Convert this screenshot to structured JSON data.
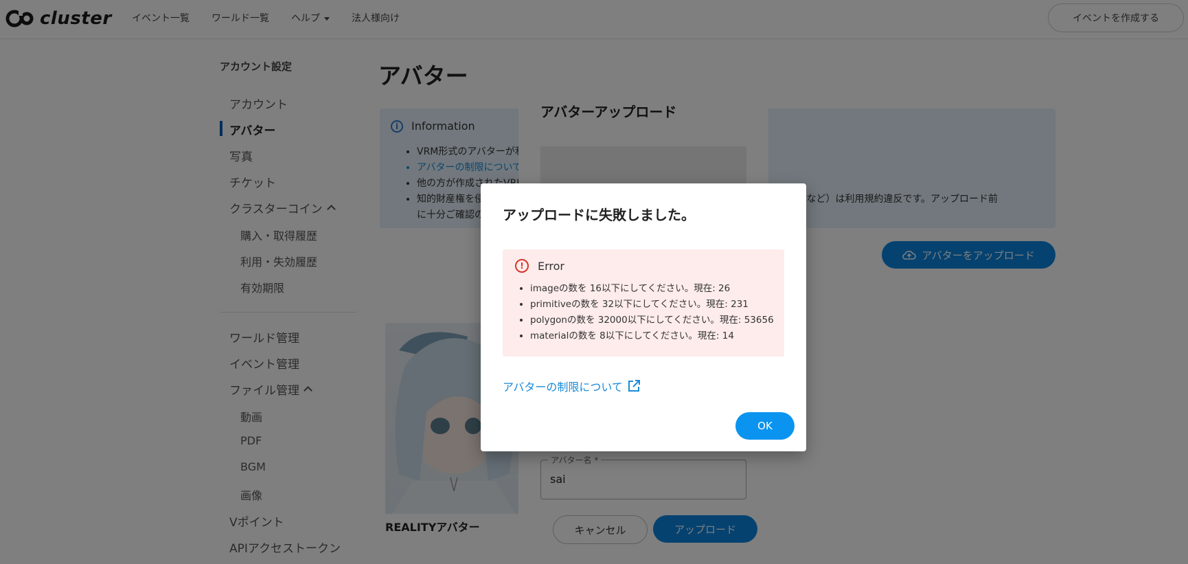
{
  "header": {
    "logo_text": "cluster",
    "nav": [
      "イベント一覧",
      "ワールド一覧",
      "ヘルプ",
      "法人様向け"
    ],
    "create_event_label": "イベントを作成する"
  },
  "sidebar": {
    "title": "アカウント設定",
    "items": {
      "account": "アカウント",
      "avatar": "アバター",
      "photo": "写真",
      "ticket": "チケット",
      "cluster_coin": "クラスターコイン",
      "purchase_history": "購入・取得履歴",
      "usage_history": "利用・失効履歴",
      "expiry": "有効期限",
      "world_manage": "ワールド管理",
      "event_manage": "イベント管理",
      "file_manage": "ファイル管理",
      "video": "動画",
      "pdf": "PDF",
      "bgm": "BGM",
      "image": "画像",
      "vpoint": "Vポイント",
      "api_token": "APIアクセストークン"
    }
  },
  "main": {
    "title": "アバター",
    "info": {
      "heading": "Information",
      "items": [
        "VRM形式のアバターが利用",
        "アバターの制限について",
        "他の方が作成されたVRM",
        "知的財産権を侵害"
      ],
      "item4_tail": "ラクターなど）は利用規約違反です。アップロード前",
      "item4_line2": "に十分ご確認の上"
    },
    "upload_avatar_label": "アバターをアップロード",
    "avatar_caption": "REALITYアバター"
  },
  "upload_modal": {
    "title": "アバターアップロード",
    "name_label": "アバター名 *",
    "name_value": "sai",
    "cancel_label": "キャンセル",
    "upload_label": "アップロード"
  },
  "dialog": {
    "title": "アップロードに失敗しました。",
    "error_heading": "Error",
    "errors": [
      "imageの数を 16以下にしてください。現在: 26",
      "primitiveの数を 32以下にしてください。現在: 231",
      "polygonの数を 32000以下にしてください。現在: 53656",
      "materialの数を 8以下にしてください。現在: 14"
    ],
    "limit_link": "アバターの制限について",
    "ok_label": "OK"
  },
  "colors": {
    "accent": "#0a84e0",
    "error": "#d9342b",
    "error_bg": "#fdeceb",
    "info_bg": "#e4f1fb",
    "link": "#1a8ad8"
  }
}
